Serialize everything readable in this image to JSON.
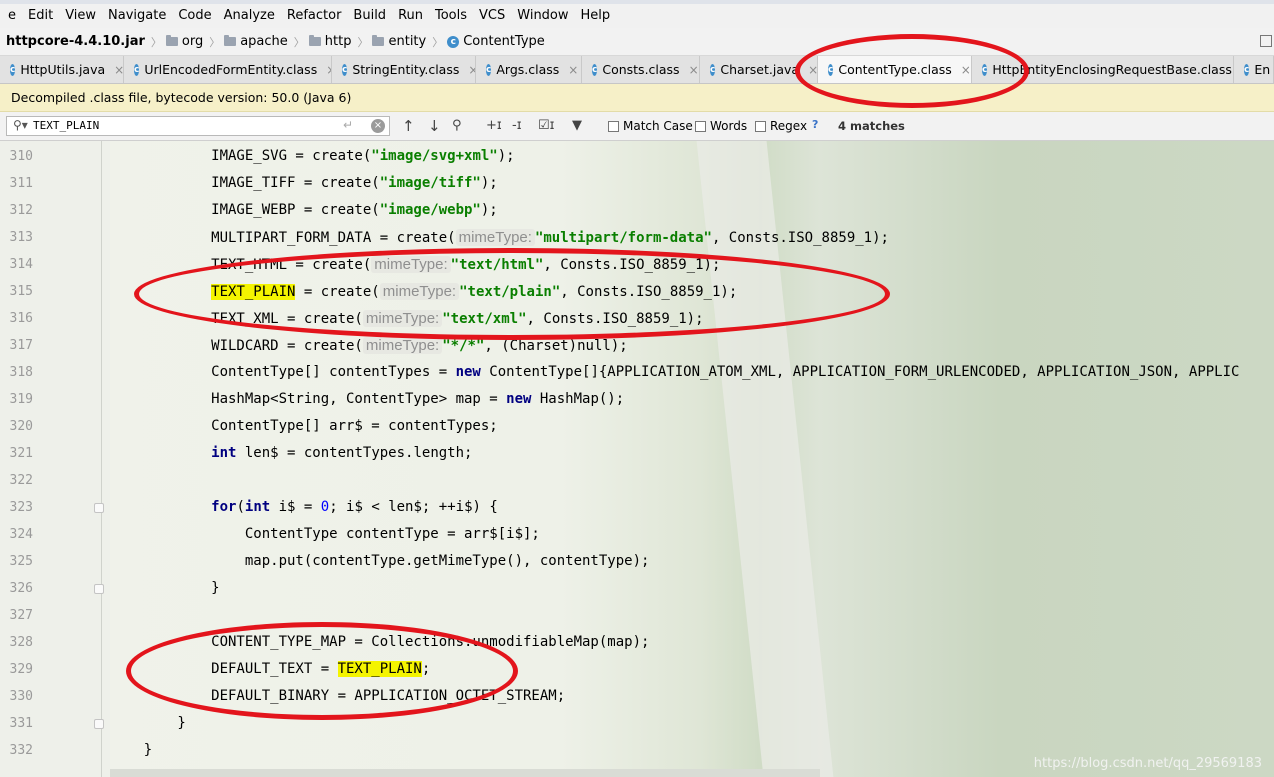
{
  "menubar": {
    "items": [
      "e",
      "Edit",
      "View",
      "Navigate",
      "Code",
      "Analyze",
      "Refactor",
      "Build",
      "Run",
      "Tools",
      "VCS",
      "Window",
      "Help"
    ]
  },
  "navbar": {
    "root": "httpcore-4.4.10.jar",
    "crumbs": [
      "org",
      "apache",
      "http",
      "entity"
    ],
    "current": "ContentType"
  },
  "tabs": [
    {
      "label": "HttpUtils.java",
      "close": "×"
    },
    {
      "label": "UrlEncodedFormEntity.class",
      "close": "×"
    },
    {
      "label": "StringEntity.class",
      "close": "×"
    },
    {
      "label": "Args.class",
      "close": "×"
    },
    {
      "label": "Consts.class",
      "close": "×"
    },
    {
      "label": "Charset.java",
      "close": "×"
    },
    {
      "label": "ContentType.class",
      "close": "×"
    },
    {
      "label": "HttpEntityEnclosingRequestBase.class",
      "close": "×"
    },
    {
      "label": "En",
      "close": ""
    }
  ],
  "active_tab": "ContentType.class",
  "banner": {
    "text": "Decompiled .class file, bytecode version: 50.0 (Java 6)"
  },
  "search": {
    "query": "TEXT_PLAIN",
    "match_case": "Match Case",
    "words": "Words",
    "regex": "Regex",
    "help": "?",
    "matches": "4 matches"
  },
  "icons": {
    "search": "search-icon",
    "clear": "clear-icon",
    "up": "arrow-up-icon",
    "down": "arrow-down-icon",
    "find_all": "find-usages-icon",
    "add_selection": "add-selection-icon",
    "remove_selection": "remove-selection-icon",
    "select_all": "select-all-occurrences-icon",
    "filter": "filter-icon"
  },
  "line_numbers": [
    "310",
    "311",
    "312",
    "313",
    "314",
    "315",
    "316",
    "317",
    "318",
    "319",
    "320",
    "321",
    "322",
    "323",
    "324",
    "325",
    "326",
    "327",
    "328",
    "329",
    "330",
    "331",
    "332"
  ],
  "code": {
    "l310": [
      "            IMAGE_SVG = create(",
      "\"image/svg+xml\"",
      ");"
    ],
    "l311": [
      "            IMAGE_TIFF = create(",
      "\"image/tiff\"",
      ");"
    ],
    "l312": [
      "            IMAGE_WEBP = create(",
      "\"image/webp\"",
      ");"
    ],
    "l313": [
      "            MULTIPART_FORM_DATA = create(",
      "mimeType:",
      "\"multipart/form-data\"",
      ", Consts.ISO_8859_1);"
    ],
    "l314": [
      "            TEXT_HTML = create(",
      "mimeType:",
      "\"text/html\"",
      ", Consts.ISO_8859_1);"
    ],
    "l315": [
      "            ",
      "TEXT_PLAIN",
      " = create(",
      "mimeType:",
      "\"text/plain\"",
      ", Consts.ISO_8859_1);"
    ],
    "l316": [
      "            TEXT_XML = create(",
      "mimeType:",
      "\"text/xml\"",
      ", Consts.ISO_8859_1);"
    ],
    "l317": [
      "            WILDCARD = create(",
      "mimeType:",
      "\"*/*\"",
      ", (Charset)null);"
    ],
    "l318": [
      "            ContentType[] contentTypes = ",
      "new",
      " ContentType[]{APPLICATION_ATOM_XML, APPLICATION_FORM_URLENCODED, APPLICATION_JSON, APPLIC"
    ],
    "l319": [
      "            HashMap<String, ContentType> map = ",
      "new",
      " HashMap();"
    ],
    "l320": [
      "            ContentType[] arr$ = contentTypes;"
    ],
    "l321": [
      "            ",
      "int",
      " len$ = contentTypes.length;"
    ],
    "l322": [
      ""
    ],
    "l323": [
      "            ",
      "for",
      "(",
      "int",
      " i$ = ",
      "0",
      "; i$ < len$; ++i$) {"
    ],
    "l324": [
      "                ContentType contentType = arr$[i$];"
    ],
    "l325": [
      "                map.put(contentType.getMimeType(), contentType);"
    ],
    "l326": [
      "            }"
    ],
    "l327": [
      ""
    ],
    "l328": [
      "            CONTENT_TYPE_MAP = Collections.unmodifiableMap(map);"
    ],
    "l329": [
      "            DEFAULT_TEXT = ",
      "TEXT_PLAIN",
      ";"
    ],
    "l330": [
      "            DEFAULT_BINARY = APPLICATION_OCTET_STREAM;"
    ],
    "l331": [
      "        }"
    ],
    "l332": [
      "    }"
    ]
  },
  "watermark": "https://blog.csdn.net/qq_29569183",
  "colors": {
    "highlight": "#f4f400",
    "string": "#0a7f00",
    "keyword": "#000080",
    "annotation": "#e3151c",
    "banner": "#f6f0c8"
  }
}
